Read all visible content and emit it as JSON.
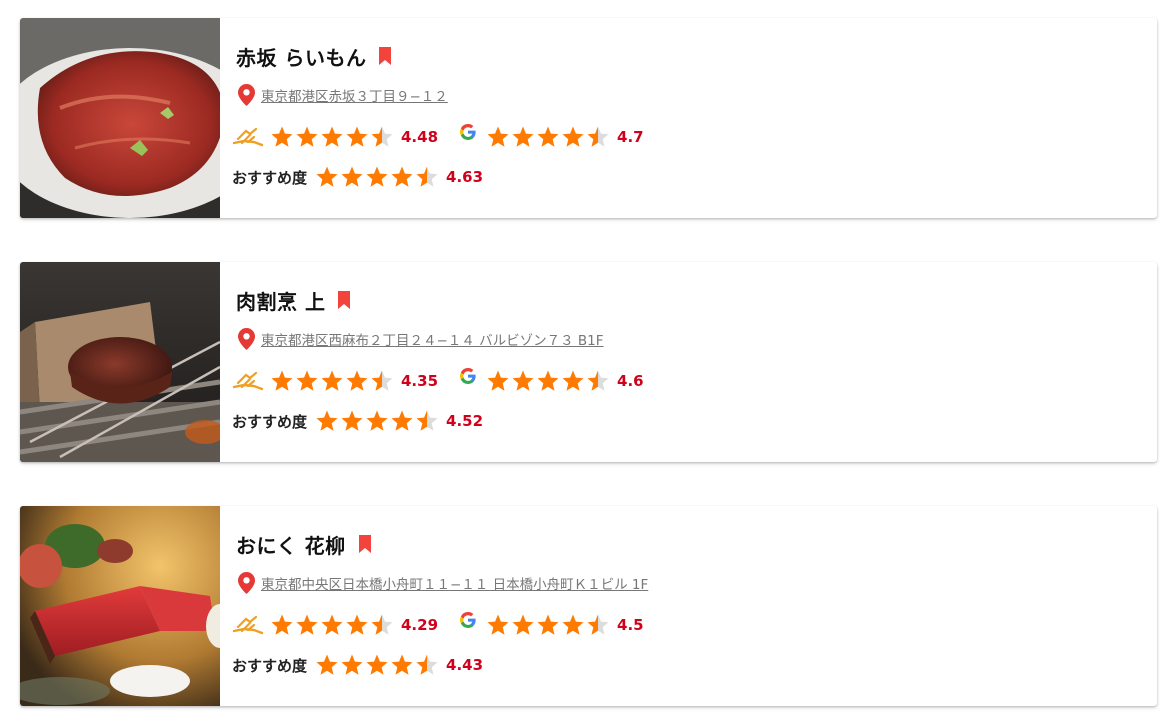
{
  "colors": {
    "star_on": "#ff7a00",
    "star_off": "#dcdcdc",
    "score": "#d0021b",
    "bookmark": "#f2433d",
    "pin": "#e53935"
  },
  "icons": {
    "tabelog": "tabelog-hand-icon",
    "google": "google-icon",
    "bookmark": "bookmark-icon",
    "location": "location-pin-icon",
    "star": "star-icon"
  },
  "recommend_label": "おすすめ度",
  "restaurants": [
    {
      "name": "赤坂 らいもん",
      "address": "東京都港区赤坂３丁目９−１２",
      "tabelog_rating": 4.48,
      "tabelog_text": "4.48",
      "google_rating": 4.7,
      "google_text": "4.7",
      "recommend_rating": 4.63,
      "recommend_text": "4.63",
      "image": "grilled-beef-slices-photo"
    },
    {
      "name": "肉割烹 上",
      "address": "東京都港区西麻布２丁目２４−１４ バルビゾン７３ B1F",
      "tabelog_rating": 4.35,
      "tabelog_text": "4.35",
      "google_rating": 4.6,
      "google_text": "4.6",
      "recommend_rating": 4.52,
      "recommend_text": "4.52",
      "image": "charcoal-grilled-steak-photo"
    },
    {
      "name": "おにく 花柳",
      "address": "東京都中央区日本橋小舟町１１−１１ 日本橋小舟町Ｋ１ビル 1F",
      "tabelog_rating": 4.29,
      "tabelog_text": "4.29",
      "google_rating": 4.5,
      "google_text": "4.5",
      "recommend_rating": 4.43,
      "recommend_text": "4.43",
      "image": "roast-beef-with-salt-photo"
    }
  ]
}
